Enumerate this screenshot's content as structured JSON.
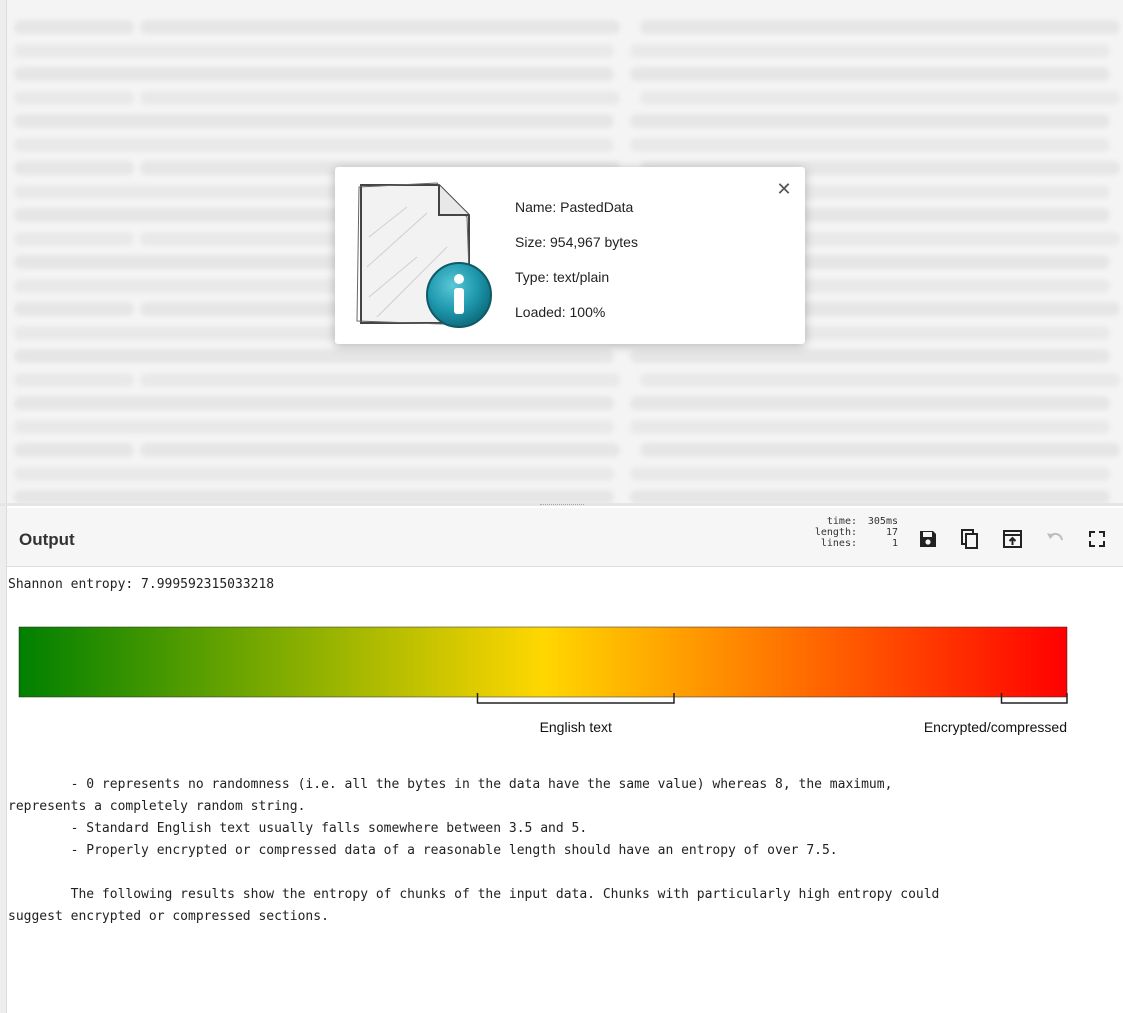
{
  "file_popup": {
    "name_line": "Name: PastedData",
    "size_line": "Size: 954,967 bytes",
    "type_line": "Type: text/plain",
    "loaded_line": "Loaded: 100%",
    "close_symbol": "✕",
    "icon": "file-info-icon"
  },
  "output": {
    "title": "Output",
    "stats": [
      {
        "label": "time:",
        "value": "305ms"
      },
      {
        "label": "length:",
        "value": "17"
      },
      {
        "label": "lines:",
        "value": "1"
      }
    ],
    "toolbar": {
      "save_icon": "save-icon",
      "copy_icon": "copy-icon",
      "replace_input_icon": "replace-input-icon",
      "undo_icon": "undo-icon",
      "maximise_icon": "maximise-icon"
    },
    "entropy_text": "Shannon entropy: 7.999592315033218",
    "scale": {
      "english_label": "English text",
      "encrypted_label": "Encrypted/compressed",
      "gradient_colors": [
        "#008000",
        "#ffd700",
        "#ff0000"
      ],
      "english_range": [
        3.5,
        5
      ],
      "encrypted_range": [
        7.5,
        8
      ],
      "max": 8
    },
    "notes": [
      "        - 0 represents no randomness (i.e. all the bytes in the data have the same value) whereas 8, the maximum,",
      "represents a completely random string.",
      "        - Standard English text usually falls somewhere between 3.5 and 5.",
      "        - Properly encrypted or compressed data of a reasonable length should have an entropy of over 7.5.",
      "",
      "        The following results show the entropy of chunks of the input data. Chunks with particularly high entropy could",
      "suggest encrypted or compressed sections."
    ]
  }
}
